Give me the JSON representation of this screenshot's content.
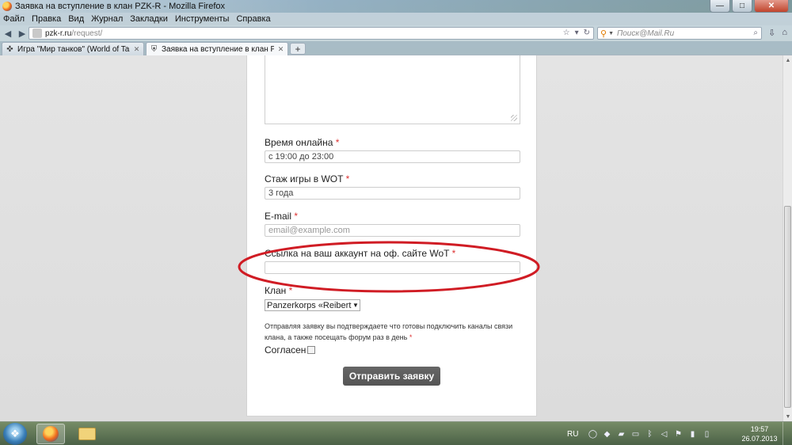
{
  "window": {
    "title": "Заявка на вступление в клан PZK-R - Mozilla Firefox",
    "min_glyph": "—",
    "max_glyph": "□",
    "close_glyph": "✕"
  },
  "menu": [
    "Файл",
    "Правка",
    "Вид",
    "Журнал",
    "Закладки",
    "Инструменты",
    "Справка"
  ],
  "nav": {
    "back_glyph": "◀",
    "forward_glyph": "▶",
    "url_domain": "pzk-r.ru",
    "url_path": "/request/",
    "search_placeholder": "Поиск@Mail.Ru"
  },
  "tabs": [
    {
      "label": "Игра \"Мир танков\" (World of Tanks)...",
      "icon": "crosshair-icon",
      "active": false
    },
    {
      "label": "Заявка на вступление в клан PZK-R",
      "icon": "shield-icon",
      "active": true
    }
  ],
  "new_tab_glyph": "+",
  "form": {
    "online_time": {
      "label": "Время онлайна",
      "value": "с 19:00 до 23:00"
    },
    "experience": {
      "label": "Стаж игры в WOT",
      "value": "3 года"
    },
    "email": {
      "label": "E-mail",
      "placeholder": "email@example.com"
    },
    "account_link": {
      "label": "Ссылка на ваш аккаунт на оф. сайте WoT",
      "value": ""
    },
    "clan": {
      "label": "Клан",
      "selected": "Panzerkorps «Reibert» II"
    },
    "required_mark": "*",
    "notice": "Отправляя заявку вы подтверждаете что готовы подключить каналы связи клана, а также посещать форум раз в день",
    "agree_label": "Согласен",
    "agree_checked": false,
    "submit_label": "Отправить заявку"
  },
  "annotation": {
    "color": "#d01c24"
  },
  "taskbar": {
    "language": "RU",
    "time": "19:57",
    "date": "26.07.2013"
  }
}
